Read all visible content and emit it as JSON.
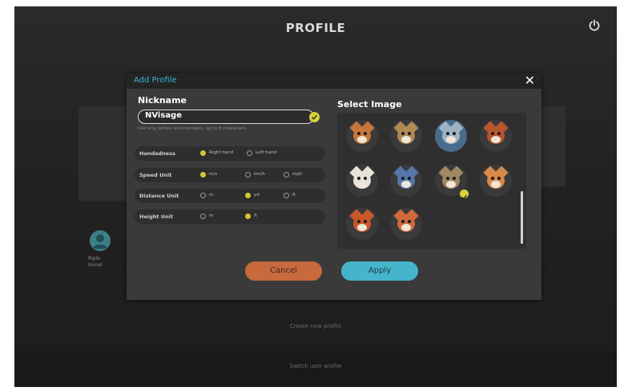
{
  "app": {
    "title": "PROFILE",
    "power_icon": "power-icon"
  },
  "background": {
    "profile_name": "Riple Hunel",
    "footer_line1": "Create new profile",
    "footer_line2": "Switch user profile"
  },
  "dialog": {
    "title": "Add Profile",
    "close_label": "✕",
    "nickname": {
      "label": "Nickname",
      "value": "NVisage",
      "hint": "Use only letters and numbers, up to 8 characters."
    },
    "settings": [
      {
        "label": "Handedness",
        "options": [
          "Right hand",
          "Left hand"
        ],
        "selected": 0
      },
      {
        "label": "Speed Unit",
        "options": [
          "m/s",
          "km/h",
          "mph"
        ],
        "selected": 0
      },
      {
        "label": "Distance Unit",
        "options": [
          "m",
          "yd",
          "ft"
        ],
        "selected": 1
      },
      {
        "label": "Height Unit",
        "options": [
          "m",
          "ft"
        ],
        "selected": 1
      }
    ],
    "select_image": {
      "label": "Select Image",
      "images": [
        {
          "name": "fox-avatar-1",
          "fur": "#c8753a",
          "bg": "#3a3a3a"
        },
        {
          "name": "lynx-avatar",
          "fur": "#b08a55",
          "bg": "#3a3a3a"
        },
        {
          "name": "koala-avatar",
          "fur": "#9fb3c4",
          "bg": "#4a6c8c"
        },
        {
          "name": "fox-avatar-2",
          "fur": "#b9562f",
          "bg": "#3a3a3a"
        },
        {
          "name": "panda-avatar",
          "fur": "#e8e2d8",
          "bg": "#3a3a3a"
        },
        {
          "name": "wolf-avatar",
          "fur": "#5577a8",
          "bg": "#3a3a3a"
        },
        {
          "name": "owl-avatar",
          "fur": "#a08763",
          "bg": "#3a3a3a"
        },
        {
          "name": "cat-avatar",
          "fur": "#d88a4a",
          "bg": "#3a3a3a"
        },
        {
          "name": "fox-avatar-3",
          "fur": "#c9572a",
          "bg": "#3a3a3a"
        },
        {
          "name": "fox-avatar-4",
          "fur": "#d06a3a",
          "bg": "#3a3a3a"
        }
      ],
      "selected": 6
    },
    "cancel_label": "Cancel",
    "apply_label": "Apply"
  },
  "colors": {
    "accent_teal": "#45b5cc",
    "accent_orange": "#c8693e",
    "selected_yellow": "#d6d43a"
  }
}
